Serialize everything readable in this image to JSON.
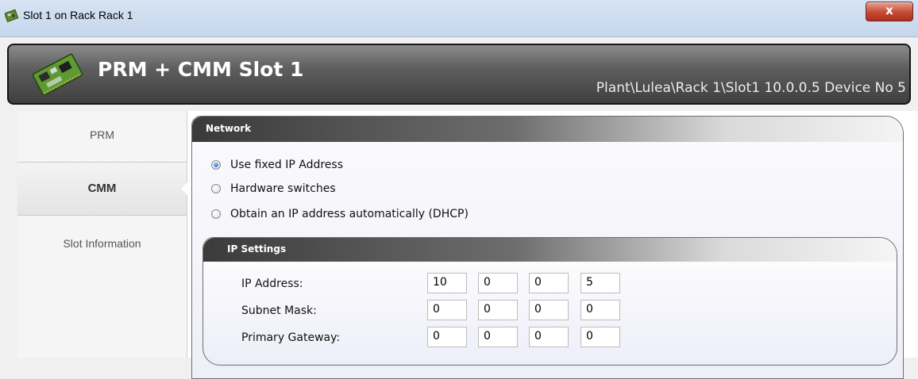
{
  "window": {
    "title": "Slot 1 on Rack Rack 1",
    "close_label": "x"
  },
  "header": {
    "title": "PRM + CMM Slot 1",
    "path": "Plant\\Lulea\\Rack 1\\Slot1 10.0.0.5 Device No 5"
  },
  "nav": {
    "items": [
      {
        "label": "PRM",
        "selected": false
      },
      {
        "label": "CMM",
        "selected": true
      },
      {
        "label": "Slot Information",
        "selected": false
      }
    ]
  },
  "network": {
    "title": "Network",
    "options": [
      {
        "label": "Use fixed IP Address",
        "checked": true
      },
      {
        "label": "Hardware switches",
        "checked": false
      },
      {
        "label": "Obtain an IP address automatically (DHCP)",
        "checked": false
      }
    ]
  },
  "ip_settings": {
    "title": "IP Settings",
    "fields": [
      {
        "label": "IP Address:",
        "octets": [
          "10",
          "0",
          "0",
          "5"
        ]
      },
      {
        "label": "Subnet Mask:",
        "octets": [
          "0",
          "0",
          "0",
          "0"
        ]
      },
      {
        "label": "Primary Gateway:",
        "octets": [
          "0",
          "0",
          "0",
          "0"
        ]
      }
    ]
  },
  "icons": {
    "app": "circuit-board-icon",
    "banner": "circuit-board-icon",
    "close": "close-icon"
  },
  "colors": {
    "close_button": "#c54a33",
    "banner_bg": "#4a4a4a",
    "radio_selected": "#1a5fc4"
  }
}
